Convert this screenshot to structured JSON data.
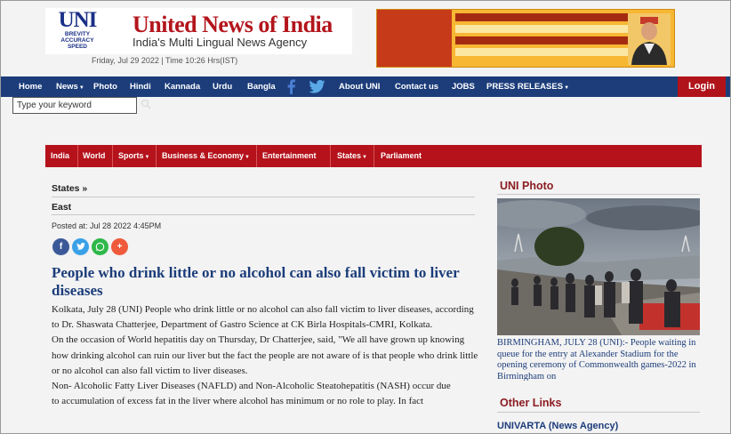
{
  "header": {
    "logo_big": "UNI",
    "logo_line1": "BREVITY",
    "logo_line2": "ACCURACY",
    "logo_line3": "SPEED",
    "title": "United News of India",
    "tagline": "India's Multi Lingual News Agency",
    "datetime": "Friday, Jul 29 2022 | Time 10:26 Hrs(IST)"
  },
  "nav": {
    "items": [
      "Home",
      "News",
      "Photo",
      "Hindi",
      "Kannada",
      "Urdu",
      "Bangla",
      "About UNI",
      "Contact us",
      "JOBS",
      "PRESS RELEASES"
    ],
    "social_icons": [
      "facebook-icon",
      "twitter-icon"
    ],
    "login": "Login"
  },
  "search": {
    "placeholder": "Type your keyword"
  },
  "categories": [
    "India",
    "World",
    "Sports",
    "Business & Economy",
    "Entertainment",
    "States",
    "Parliament"
  ],
  "article": {
    "breadcrumb": "States »",
    "section": "East",
    "posted": "Posted at: Jul 28 2022 4:45PM",
    "share_icons": [
      "facebook-share-icon",
      "twitter-share-icon",
      "whatsapp-share-icon",
      "more-share-icon"
    ],
    "headline": "People who drink little or no alcohol can also fall victim to liver diseases",
    "paragraphs": [
      "Kolkata, July 28 (UNI) People who drink little or no alcohol can also fall victim to liver diseases, according to Dr. Shaswata Chatterjee, Department of Gastro Science at CK Birla Hospitals-CMRI, Kolkata.",
      "On the occasion of World hepatitis day on Thursday, Dr Chatterjee, said, \"We all have grown up knowing how drinking alcohol can ruin our liver but the fact the people are not aware of is that people who drink little or no alcohol can also fall victim to liver diseases.",
      "Non- Alcoholic Fatty Liver Diseases (NAFLD) and Non-Alcoholic Steatohepatitis (NASH) occur due",
      "to accumulation of excess fat in the liver where alcohol has minimum or no role to play. In fact"
    ]
  },
  "sidebar": {
    "photo_title": "UNI Photo",
    "photo_caption": "BIRMINGHAM, JULY 28 (UNI):- People waiting in queue for the entry at Alexander Stadium for the opening ceremony of Commonwealth games-2022 in Birmingham on",
    "other_links_title": "Other Links",
    "other_links": [
      "UNIVARTA (News Agency)"
    ]
  },
  "colors": {
    "nav_blue": "#1c3d7a",
    "brand_red": "#b5121b",
    "headline_blue": "#1c3d7a",
    "sidebar_title": "#8b1d22"
  }
}
